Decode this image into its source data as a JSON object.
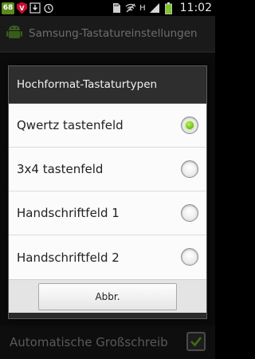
{
  "status_bar": {
    "notification_badge": "68",
    "shield_label": "V",
    "network_type": "H",
    "time": "11:02",
    "icons": [
      "download-icon",
      "alarm-icon",
      "sd-card-icon",
      "wifi-off-icon",
      "signal-icon",
      "battery-icon"
    ]
  },
  "app_bar": {
    "title": "Samsung-Tastatureinstellungen",
    "icon": "android-icon"
  },
  "dialog": {
    "title": "Hochformat-Tastaturtypen",
    "options": [
      {
        "label": "Qwertz tastenfeld",
        "selected": true
      },
      {
        "label": "3x4 tastenfeld",
        "selected": false
      },
      {
        "label": "Handschriftfeld 1",
        "selected": false
      },
      {
        "label": "Handschriftfeld 2",
        "selected": false
      }
    ],
    "cancel_label": "Abbr."
  },
  "background_setting": {
    "label": "Automatische Großschreib",
    "checked": true
  },
  "colors": {
    "radio_selected": "#7dc71d",
    "badge": "#5c8a1e",
    "shield": "#c8102e"
  }
}
